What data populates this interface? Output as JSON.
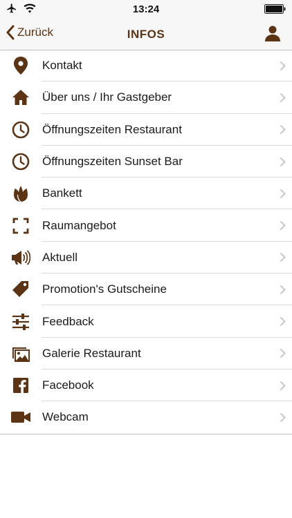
{
  "status_bar": {
    "time": "13:24",
    "left_icons": [
      "airplane-icon",
      "wifi-icon"
    ],
    "right_icons": [
      "battery-icon"
    ]
  },
  "nav": {
    "back_label": "Zurück",
    "title": "INFOS",
    "right_icon": "person-icon"
  },
  "colors": {
    "accent": "#5b3416",
    "chevron": "#c7c7cc",
    "separator": "#d9d9d9"
  },
  "menu": {
    "items": [
      {
        "label": "Kontakt",
        "icon": "location-pin-icon"
      },
      {
        "label": "Über uns / Ihr Gastgeber",
        "icon": "home-icon"
      },
      {
        "label": "Öffnungszeiten Restaurant",
        "icon": "clock-icon"
      },
      {
        "label": "Öffnungszeiten Sunset Bar",
        "icon": "clock-icon"
      },
      {
        "label": "Bankett",
        "icon": "tulip-icon"
      },
      {
        "label": "Raumangebot",
        "icon": "frame-corners-icon"
      },
      {
        "label": "Aktuell",
        "icon": "megaphone-icon"
      },
      {
        "label": "Promotion's Gutscheine",
        "icon": "tag-icon"
      },
      {
        "label": "Feedback",
        "icon": "sliders-icon"
      },
      {
        "label": "Galerie Restaurant",
        "icon": "gallery-icon"
      },
      {
        "label": "Facebook",
        "icon": "facebook-icon"
      },
      {
        "label": "Webcam",
        "icon": "video-camera-icon"
      }
    ]
  }
}
